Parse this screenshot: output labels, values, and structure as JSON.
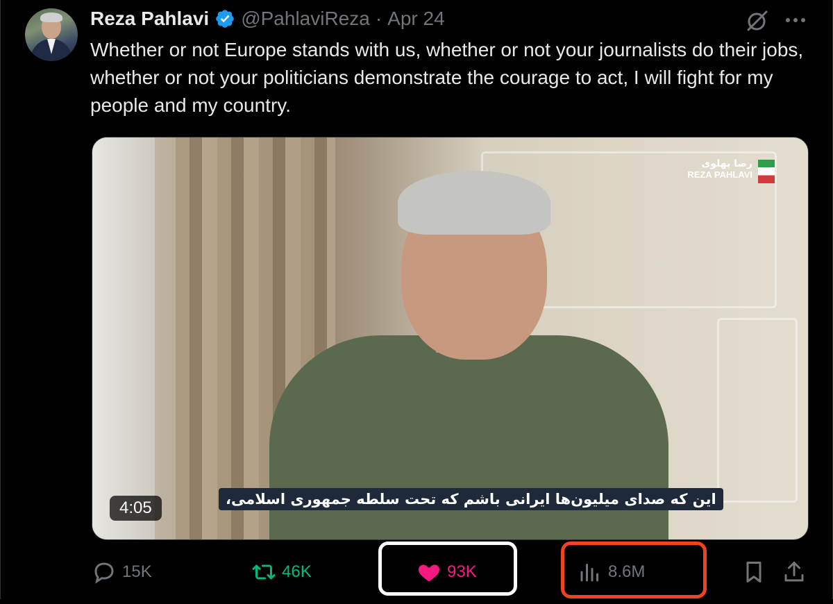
{
  "tweet": {
    "author_name": "Reza Pahlavi",
    "handle": "@PahlaviReza",
    "separator": "·",
    "date": "Apr 24",
    "text": "Whether or not Europe stands with us, whether or not your journalists do their jobs, whether or not your politicians demonstrate the courage to act, I will fight for my people and my country."
  },
  "media": {
    "duration": "4:05",
    "caption": "این که صدای میلیون‌ها ایرانی باشم که تحت سلطه جمهوری اسلامی،",
    "brand_fa": "رضا پهلوی",
    "brand_en": "REZA PAHLAVI"
  },
  "actions": {
    "replies": "15K",
    "reposts": "46K",
    "likes": "93K",
    "views": "8.6M"
  },
  "colors": {
    "background": "#000000",
    "text": "#e7e9ea",
    "muted": "#71767b",
    "verified": "#1d9bf0",
    "repost": "#00ba7c",
    "like": "#f91880",
    "highlight_white": "#ffffff",
    "highlight_red": "#ef4424"
  },
  "icons": [
    "verified-badge-icon",
    "grok-icon",
    "more-icon",
    "reply-icon",
    "repost-icon",
    "like-icon",
    "views-icon",
    "bookmark-icon",
    "share-icon"
  ]
}
